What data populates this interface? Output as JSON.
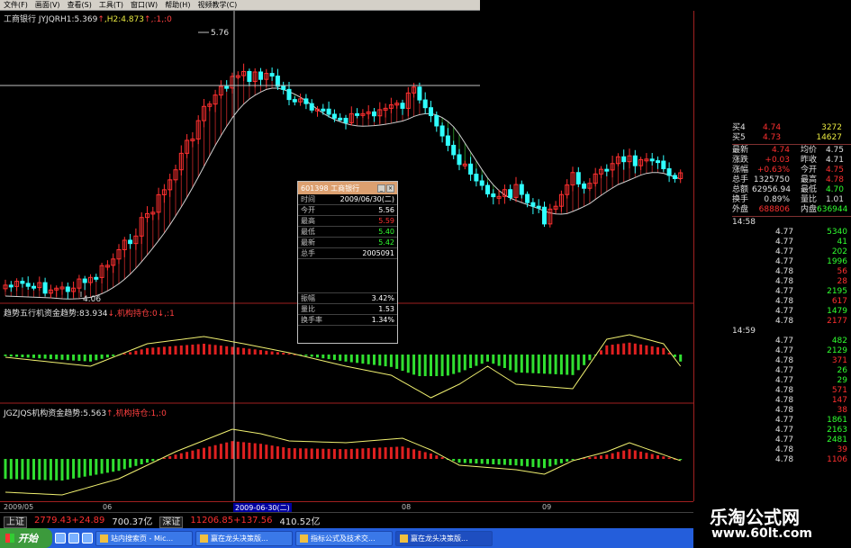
{
  "menubar": {
    "items": [
      {
        "label": "文件(F)"
      },
      {
        "label": "画面(V)"
      },
      {
        "label": "查看(S)"
      },
      {
        "label": "工具(T)"
      },
      {
        "label": "窗口(W)"
      },
      {
        "label": "帮助(H)"
      },
      {
        "label": "视频教学(C)"
      }
    ]
  },
  "chart": {
    "main_title": {
      "name": "工商银行",
      "indicator": "JYJQRH1:5.369",
      "arrow1": "↑",
      "h2": ",H2:4.873",
      "arrow2": "↑",
      "tail": ",:1,:0"
    },
    "high_label": "5.76",
    "low_label": "4.06",
    "panel2_title": {
      "text": "趋势五行机资金趋势:83.934",
      "arrow": "↓",
      "tail": ",机构持仓:0",
      "arrow2": "↓",
      "tail2": ",:1"
    },
    "panel3_title": {
      "text": "JGZJQS机构资金趋势:5.563",
      "arrow": "↑",
      "tail": ",机构持仓:1,:0"
    }
  },
  "popup": {
    "title": "601398 工商银行",
    "rows": [
      {
        "key": "时间",
        "value": "2009/06/30(二)",
        "color": "w"
      },
      {
        "key": "今开",
        "value": "5.56",
        "color": "w"
      },
      {
        "key": "最高",
        "value": "5.59",
        "color": "r"
      },
      {
        "key": "最低",
        "value": "5.40",
        "color": "g"
      },
      {
        "key": "最新",
        "value": "5.42",
        "color": "g"
      },
      {
        "key": "总手",
        "value": "2005091",
        "color": "w"
      }
    ],
    "rows2": [
      {
        "key": "振幅",
        "value": "3.42%",
        "color": "w"
      },
      {
        "key": "量比",
        "value": "1.53",
        "color": "w"
      },
      {
        "key": "换手率",
        "value": "1.34%",
        "color": "w"
      }
    ]
  },
  "quote": {
    "asks": [
      {
        "label": "买4",
        "price": "4.74",
        "vol": "3272"
      },
      {
        "label": "买5",
        "price": "4.73",
        "vol": "14627"
      }
    ],
    "stats": [
      {
        "k1": "最新",
        "v1": "4.74",
        "c1": "red",
        "k2": "均价",
        "v2": "4.75",
        "c2": "white"
      },
      {
        "k1": "涨跌",
        "v1": "+0.03",
        "c1": "red",
        "k2": "昨收",
        "v2": "4.71",
        "c2": "white"
      },
      {
        "k1": "涨幅",
        "v1": "+0.63%",
        "c1": "red",
        "k2": "今开",
        "v2": "4.75",
        "c2": "red"
      },
      {
        "k1": "总手",
        "v1": "1325750",
        "c1": "white",
        "k2": "最高",
        "v2": "4.78",
        "c2": "red"
      },
      {
        "k1": "总额",
        "v1": "62956.94",
        "c1": "white",
        "k2": "最低",
        "v2": "4.70",
        "c2": "green"
      },
      {
        "k1": "换手",
        "v1": "0.89%",
        "c1": "white",
        "k2": "量比",
        "v2": "1.01",
        "c2": "white"
      },
      {
        "k1": "外盘",
        "v1": "688806",
        "c1": "red",
        "k2": "内盘",
        "v2": "636944",
        "c2": "green"
      }
    ],
    "ticks1_time": "14:58",
    "ticks1": [
      {
        "p": "4.77",
        "v": "5340",
        "c": "green"
      },
      {
        "p": "4.77",
        "v": "41",
        "c": "green"
      },
      {
        "p": "4.77",
        "v": "202",
        "c": "green"
      },
      {
        "p": "4.77",
        "v": "1996",
        "c": "green"
      },
      {
        "p": "4.78",
        "v": "56",
        "c": "red"
      },
      {
        "p": "4.78",
        "v": "28",
        "c": "red"
      },
      {
        "p": "4.77",
        "v": "2195",
        "c": "green"
      },
      {
        "p": "4.78",
        "v": "617",
        "c": "red"
      },
      {
        "p": "4.77",
        "v": "1479",
        "c": "green"
      },
      {
        "p": "4.78",
        "v": "2177",
        "c": "red"
      }
    ],
    "ticks2_time": "14:59",
    "ticks2": [
      {
        "p": "4.77",
        "v": "482",
        "c": "green"
      },
      {
        "p": "4.77",
        "v": "2129",
        "c": "green"
      },
      {
        "p": "4.78",
        "v": "371",
        "c": "red"
      },
      {
        "p": "4.77",
        "v": "26",
        "c": "green"
      },
      {
        "p": "4.77",
        "v": "29",
        "c": "green"
      },
      {
        "p": "4.78",
        "v": "571",
        "c": "red"
      },
      {
        "p": "4.78",
        "v": "147",
        "c": "red"
      },
      {
        "p": "4.78",
        "v": "38",
        "c": "red"
      },
      {
        "p": "4.77",
        "v": "1861",
        "c": "green"
      },
      {
        "p": "4.77",
        "v": "2163",
        "c": "green"
      },
      {
        "p": "4.77",
        "v": "2481",
        "c": "green"
      },
      {
        "p": "4.78",
        "v": "39",
        "c": "red"
      },
      {
        "p": "4.78",
        "v": "1106",
        "c": "red"
      }
    ]
  },
  "dateaxis": {
    "labels": [
      {
        "text": "2009/05"
      },
      {
        "text": "06"
      },
      {
        "text": "2009-06-30(二)",
        "selected": true
      },
      {
        "text": "08"
      },
      {
        "text": "09"
      }
    ]
  },
  "statusbar": {
    "sh_label": "上证",
    "sh_value": "2779.43+24.89",
    "sh_amount": "700.37亿",
    "sz_label": "深证",
    "sz_value": "11206.85+137.56",
    "sz_amount": "410.52亿"
  },
  "watermark": {
    "big": "乐淘公式网",
    "small": "www.60lt.com"
  },
  "taskbar": {
    "start": "开始",
    "tasks": [
      {
        "label": "站内搜索页 - Mic..."
      },
      {
        "label": "赢在龙头决策版..."
      },
      {
        "label": "指标公式及技术交..."
      },
      {
        "label": "赢在龙头决策版..."
      }
    ]
  },
  "colors": {
    "up": "#ff3030",
    "down": "#30ffff",
    "ma": "#d0d0d0",
    "fill_up": "#a02020",
    "fill_down": "#208020",
    "trend": "#f0f070",
    "bar_red": "#e02020",
    "bar_green": "#30e030"
  }
}
